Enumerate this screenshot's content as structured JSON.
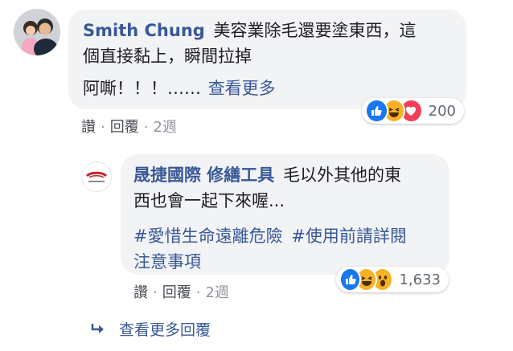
{
  "comment": {
    "author": "Smith Chung",
    "text_line1": "美容業除毛還要塗東西，這",
    "text_line2": "個直接黏上，瞬間拉掉",
    "text_line3": "阿嘶！！！……",
    "see_more": "查看更多",
    "actions": {
      "like": "讚",
      "reply": "回覆",
      "time": "2週"
    },
    "reactions": {
      "icons": [
        "like-icon",
        "haha-icon",
        "love-icon"
      ],
      "count": "200"
    }
  },
  "reply": {
    "author": "晟捷國際 修繕工具",
    "text_line1": "毛以外其他的東",
    "text_line2": "西也會一起下來喔...",
    "hashtag1": "#愛惜生命遠離危險",
    "hashtag2_part1": "#使用前請詳閱",
    "hashtag2_part2": "注意事項",
    "actions": {
      "like": "讚",
      "reply": "回覆",
      "time": "2週"
    },
    "reactions": {
      "icons": [
        "like-icon",
        "haha-icon",
        "wow-icon"
      ],
      "count": "1,633"
    }
  },
  "more_replies": {
    "icon": "reply-arrow-icon",
    "label": "查看更多回覆"
  },
  "colors": {
    "link": "#385898",
    "bubble": "#f2f3f5",
    "like": "#1877f2",
    "love": "#f33e58",
    "emoji": "#f7b125"
  }
}
